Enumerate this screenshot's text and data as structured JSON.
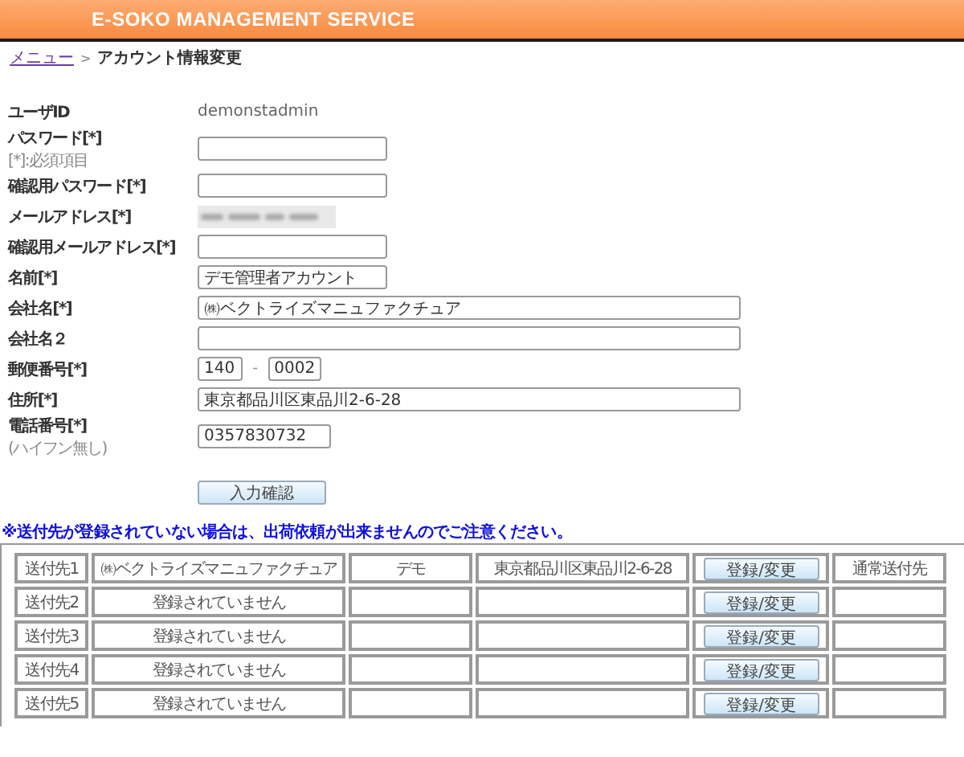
{
  "header": {
    "title": "E-SOKO MANAGEMENT SERVICE"
  },
  "breadcrumb": {
    "link": "メニュー",
    "separator": ">",
    "current": "アカウント情報変更"
  },
  "form": [
    {
      "label": "ユーザID",
      "kind": "text",
      "value": "demonstadmin"
    },
    {
      "label": "パスワード[*]",
      "hint": "[*]:必須項目",
      "kind": "short-field"
    },
    {
      "label": "確認用パスワード[*]",
      "kind": "short-field"
    },
    {
      "label": "メールアドレス[*]",
      "kind": "masked"
    },
    {
      "label": "確認用メールアドレス[*]",
      "kind": "short-field"
    },
    {
      "label": "名前[*]",
      "kind": "short-field",
      "value": "デモ管理者アカウント"
    },
    {
      "label": "会社名[*]",
      "kind": "long-field",
      "value": "㈱ベクトライズマニュファクチュア"
    },
    {
      "label": "会社名２",
      "kind": "long-field"
    },
    {
      "label": "郵便番号[*]",
      "kind": "postal",
      "value": "140",
      "value2": "0002",
      "separator": "-"
    },
    {
      "label": "住所[*]",
      "kind": "long-field",
      "value": "東京都品川区東品川2-6-28"
    },
    {
      "label": "電話番号[*]",
      "hint": "(ハイフン無し)",
      "kind": "medium-field",
      "value": "0357830732"
    }
  ],
  "submit_button": "入力確認",
  "notice": "※送付先が登録されていない場合は、出荷依頼が出来ませんのでご注意ください。",
  "destinations": [
    {
      "label": "送付先1",
      "company": "㈱ベクトライズマニュファクチュア",
      "name": "デモ",
      "address": "東京都品川区東品川2-6-28",
      "button": "登録/変更",
      "type": "通常送付先"
    },
    {
      "label": "送付先2",
      "company": "登録されていません",
      "button": "登録/変更"
    },
    {
      "label": "送付先3",
      "company": "登録されていません",
      "button": "登録/変更"
    },
    {
      "label": "送付先4",
      "company": "登録されていません",
      "button": "登録/変更"
    },
    {
      "label": "送付先5",
      "company": "登録されていません",
      "button": "登録/変更"
    }
  ]
}
